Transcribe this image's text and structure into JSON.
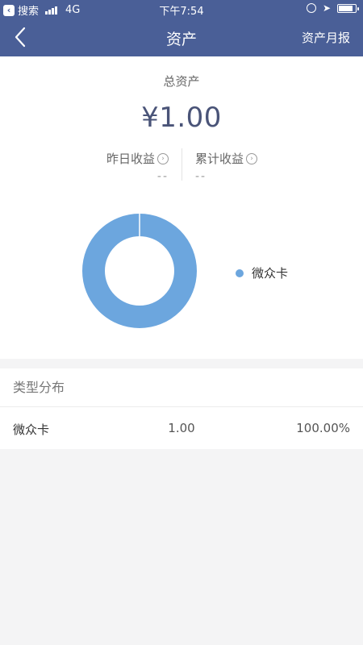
{
  "status_bar": {
    "back_app": "搜索",
    "network": "4G",
    "time": "下午7:54"
  },
  "nav": {
    "title": "资产",
    "right_action": "资产月报"
  },
  "summary": {
    "total_label": "总资产",
    "total_amount": "¥1.00",
    "yesterday_label": "昨日收益",
    "yesterday_value": "--",
    "cumulative_label": "累计收益",
    "cumulative_value": "--"
  },
  "chart_data": {
    "type": "pie",
    "categories": [
      "微众卡"
    ],
    "values": [
      1.0
    ],
    "colors": [
      "#6ca6de"
    ]
  },
  "distribution": {
    "header": "类型分布",
    "rows": [
      {
        "name": "微众卡",
        "amount": "1.00",
        "percent": "100.00%"
      }
    ]
  },
  "colors": {
    "header_bg": "#4a5f97",
    "accent": "#6ca6de",
    "amount_text": "#4a5478"
  }
}
